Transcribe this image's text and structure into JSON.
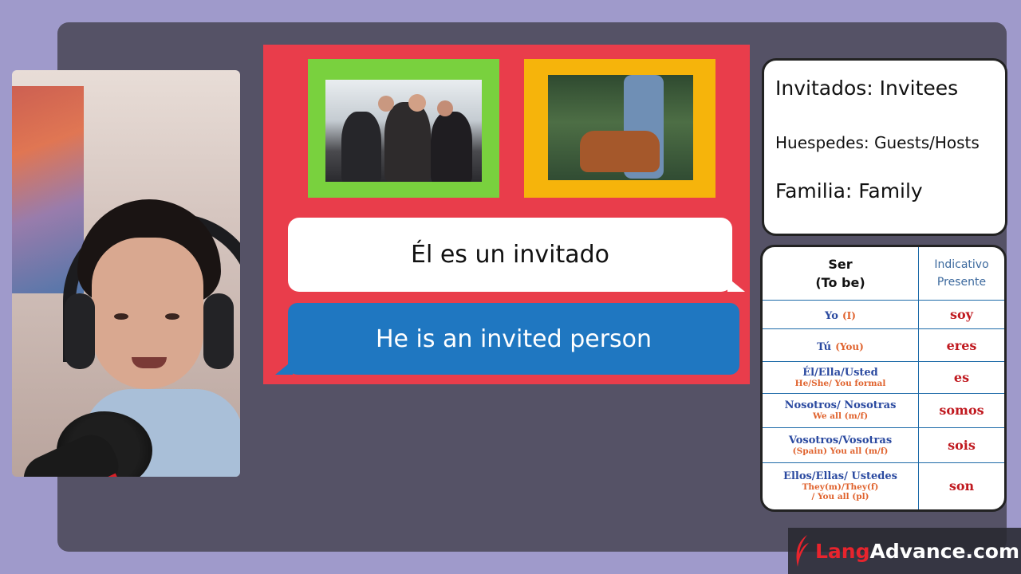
{
  "slide": {
    "spanish_sentence": "Él es un invitado",
    "english_sentence": "He is an invited person"
  },
  "vocabulary": {
    "items": [
      "Invitados: Invitees",
      "Huespedes: Guests/Hosts",
      "Familia: Family"
    ]
  },
  "conjugation": {
    "header_left_line1": "Ser",
    "header_left_line2": "(To be)",
    "header_right_line1": "Indicativo",
    "header_right_line2": "Presente",
    "rows": [
      {
        "pronoun": "Yo",
        "english": "(I)",
        "verb": "soy"
      },
      {
        "pronoun": "Tú",
        "english": "(You)",
        "verb": "eres"
      },
      {
        "pronoun": "Él/Ella/Usted",
        "english": "He/She/ You formal",
        "verb": "es"
      },
      {
        "pronoun": "Nosotros/ Nosotras",
        "english": "We all (m/f)",
        "verb": "somos"
      },
      {
        "pronoun": "Vosotros/Vosotras",
        "english": "(Spain) You all (m/f)",
        "verb": "sois"
      },
      {
        "pronoun": "Ellos/Ellas/ Ustedes",
        "english_line1": "They(m)/They(f)",
        "english_line2": "/ You all (pl)",
        "verb": "son"
      }
    ]
  },
  "watermark": {
    "brand_lang": "Lang",
    "brand_rest": "Advance.com"
  },
  "colors": {
    "slide_background": "#e93d4b",
    "green_frame": "#79d13e",
    "yellow_frame": "#f6b40b",
    "blue_bubble": "#1f77c1",
    "verb_red": "#c0191f",
    "pronoun_blue": "#2b4aa0",
    "english_orange": "#e0632e"
  },
  "icons": {
    "logo": "feather-quill-icon"
  }
}
